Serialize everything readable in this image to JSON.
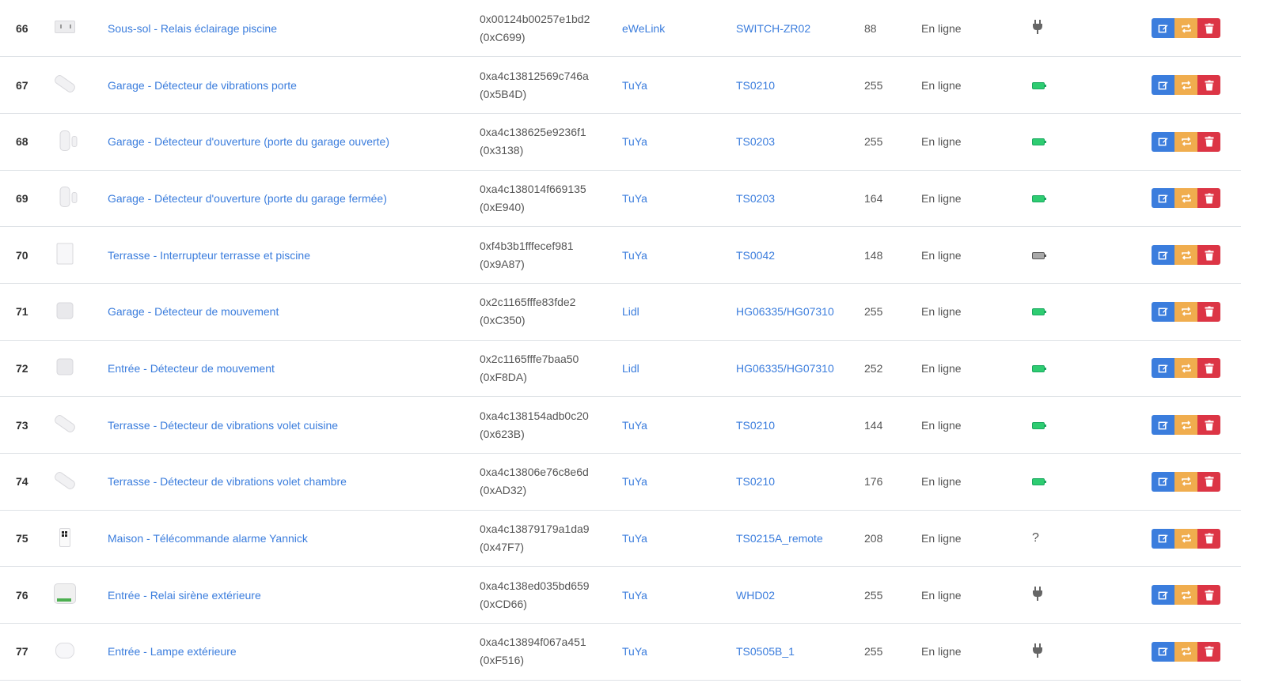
{
  "devices": [
    {
      "id": "66",
      "image": "relay-icon",
      "name": "Sous-sol - Relais éclairage piscine",
      "ieee": "0x00124b00257e1bd2",
      "nwk": "(0xC699)",
      "manufacturer": "eWeLink",
      "model": "SWITCH-ZR02",
      "lqi": "88",
      "status": "En ligne",
      "power": "mains-plug-icon"
    },
    {
      "id": "67",
      "image": "vibration-sensor-icon",
      "name": "Garage - Détecteur de vibrations porte",
      "ieee": "0xa4c13812569c746a",
      "nwk": "(0x5B4D)",
      "manufacturer": "TuYa",
      "model": "TS0210",
      "lqi": "255",
      "status": "En ligne",
      "power": "battery-icon"
    },
    {
      "id": "68",
      "image": "door-sensor-icon",
      "name": "Garage - Détecteur d'ouverture (porte du garage ouverte)",
      "ieee": "0xa4c138625e9236f1",
      "nwk": "(0x3138)",
      "manufacturer": "TuYa",
      "model": "TS0203",
      "lqi": "255",
      "status": "En ligne",
      "power": "battery-icon"
    },
    {
      "id": "69",
      "image": "door-sensor-icon",
      "name": "Garage - Détecteur d'ouverture (porte du garage fermée)",
      "ieee": "0xa4c138014f669135",
      "nwk": "(0xE940)",
      "manufacturer": "TuYa",
      "model": "TS0203",
      "lqi": "164",
      "status": "En ligne",
      "power": "battery-icon"
    },
    {
      "id": "70",
      "image": "wall-switch-icon",
      "name": "Terrasse - Interrupteur terrasse et piscine",
      "ieee": "0xf4b3b1fffecef981",
      "nwk": "(0x9A87)",
      "manufacturer": "TuYa",
      "model": "TS0042",
      "lqi": "148",
      "status": "En ligne",
      "power": "battery-unknown-icon"
    },
    {
      "id": "71",
      "image": "motion-sensor-icon",
      "name": "Garage - Détecteur de mouvement",
      "ieee": "0x2c1165fffe83fde2",
      "nwk": "(0xC350)",
      "manufacturer": "Lidl",
      "model": "HG06335/HG07310",
      "lqi": "255",
      "status": "En ligne",
      "power": "battery-icon"
    },
    {
      "id": "72",
      "image": "motion-sensor-icon",
      "name": "Entrée - Détecteur de mouvement",
      "ieee": "0x2c1165fffe7baa50",
      "nwk": "(0xF8DA)",
      "manufacturer": "Lidl",
      "model": "HG06335/HG07310",
      "lqi": "252",
      "status": "En ligne",
      "power": "battery-icon"
    },
    {
      "id": "73",
      "image": "vibration-sensor-icon",
      "name": "Terrasse - Détecteur de vibrations volet cuisine",
      "ieee": "0xa4c138154adb0c20",
      "nwk": "(0x623B)",
      "manufacturer": "TuYa",
      "model": "TS0210",
      "lqi": "144",
      "status": "En ligne",
      "power": "battery-icon"
    },
    {
      "id": "74",
      "image": "vibration-sensor-icon",
      "name": "Terrasse - Détecteur de vibrations volet chambre",
      "ieee": "0xa4c13806e76c8e6d",
      "nwk": "(0xAD32)",
      "manufacturer": "TuYa",
      "model": "TS0210",
      "lqi": "176",
      "status": "En ligne",
      "power": "battery-icon"
    },
    {
      "id": "75",
      "image": "remote-icon",
      "name": "Maison - Télécommande alarme Yannick",
      "ieee": "0xa4c13879179a1da9",
      "nwk": "(0x47F7)",
      "manufacturer": "TuYa",
      "model": "TS0215A_remote",
      "lqi": "208",
      "status": "En ligne",
      "power": "unknown-icon",
      "power_text": "?"
    },
    {
      "id": "76",
      "image": "siren-relay-icon",
      "name": "Entrée - Relai sirène extérieure",
      "ieee": "0xa4c138ed035bd659",
      "nwk": "(0xCD66)",
      "manufacturer": "TuYa",
      "model": "WHD02",
      "lqi": "255",
      "status": "En ligne",
      "power": "mains-plug-icon"
    },
    {
      "id": "77",
      "image": "lamp-icon",
      "name": "Entrée - Lampe extérieure",
      "ieee": "0xa4c13894f067a451",
      "nwk": "(0xF516)",
      "manufacturer": "TuYa",
      "model": "TS0505B_1",
      "lqi": "255",
      "status": "En ligne",
      "power": "mains-plug-icon"
    }
  ],
  "colors": {
    "link": "#3b7ddd",
    "edit": "#3b7ddd",
    "swap": "#f0ad4e",
    "delete": "#dc3545",
    "battery": "#2ecc71"
  }
}
